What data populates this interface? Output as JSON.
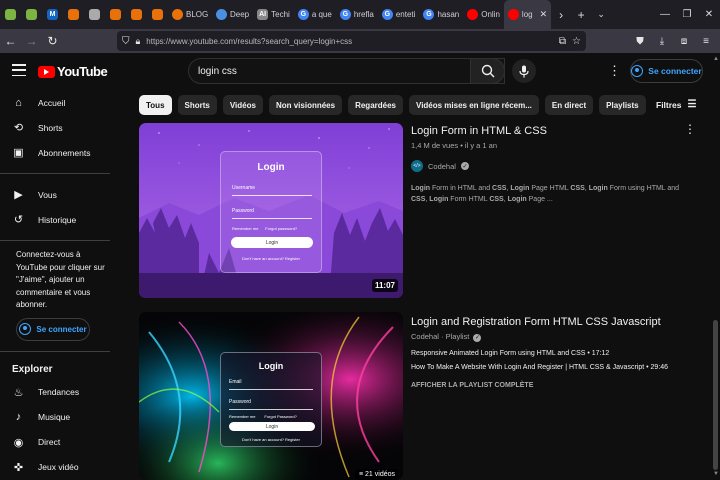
{
  "browser": {
    "tabs": [
      {
        "label": "",
        "color": "#7cb342",
        "letter": "",
        "pinned": true
      },
      {
        "label": "",
        "color": "#7cb342",
        "letter": "",
        "pinned": true
      },
      {
        "label": "",
        "color": "#1565c0",
        "letter": "M",
        "pinned": true
      },
      {
        "label": "",
        "color": "#e8710a",
        "letter": "",
        "pinned": true
      },
      {
        "label": "",
        "color": "#aaaaaa",
        "letter": "",
        "pinned": true
      },
      {
        "label": "",
        "color": "#e8710a",
        "letter": "",
        "pinned": true
      },
      {
        "label": "",
        "color": "#e8710a",
        "letter": "",
        "pinned": true
      },
      {
        "label": "",
        "color": "#e8710a",
        "letter": "",
        "pinned": true
      },
      {
        "label": "BLOG",
        "color": "#e8710a",
        "letter": ""
      },
      {
        "label": "Deep",
        "color": "#4a90e2",
        "letter": ""
      },
      {
        "label": "Techi",
        "color": "#888888",
        "letter": "AI"
      },
      {
        "label": "a que",
        "color": "#4285f4",
        "letter": "G"
      },
      {
        "label": "hrefla",
        "color": "#4285f4",
        "letter": "G"
      },
      {
        "label": "enteti",
        "color": "#4285f4",
        "letter": "G",
        "selected": true
      },
      {
        "label": "hasan",
        "color": "#4285f4",
        "letter": "G"
      },
      {
        "label": "Onlin",
        "color": "#ff0000",
        "letter": ""
      },
      {
        "label": "log",
        "color": "#ff0000",
        "letter": "",
        "active": true
      }
    ],
    "url": "https://www.youtube.com/results?search_query=login+css"
  },
  "header": {
    "logo_text": "YouTube",
    "search_value": "login css",
    "signin_label": "Se connecter"
  },
  "sidebar": {
    "items": [
      {
        "label": "Accueil",
        "icon": "home-icon",
        "glyph": "⌂"
      },
      {
        "label": "Shorts",
        "icon": "shorts-icon",
        "glyph": "⟲"
      },
      {
        "label": "Abonnements",
        "icon": "subscriptions-icon",
        "glyph": "▣"
      }
    ],
    "items2": [
      {
        "label": "Vous",
        "icon": "you-icon",
        "glyph": "▶"
      },
      {
        "label": "Historique",
        "icon": "history-icon",
        "glyph": "↺"
      }
    ],
    "signin_message": "Connectez-vous à YouTube pour cliquer sur \"J'aime\", ajouter un commentaire et vous abonner.",
    "signin_label": "Se connecter",
    "explore_title": "Explorer",
    "explore_items": [
      {
        "label": "Tendances",
        "icon": "trending-icon",
        "glyph": "♨"
      },
      {
        "label": "Musique",
        "icon": "music-icon",
        "glyph": "♪"
      },
      {
        "label": "Direct",
        "icon": "live-icon",
        "glyph": "◉"
      },
      {
        "label": "Jeux vidéo",
        "icon": "gaming-icon",
        "glyph": "✜"
      }
    ]
  },
  "chips": [
    "Tous",
    "Shorts",
    "Vidéos",
    "Non visionnées",
    "Regardées",
    "Vidéos mises en ligne récem...",
    "En direct",
    "Playlists"
  ],
  "filters_label": "Filtres",
  "results": [
    {
      "title": "Login Form in HTML & CSS",
      "meta": "1,4 M de vues • il y a 1 an",
      "channel": "Codehal",
      "duration": "11:07",
      "description_parts": [
        "Login",
        " Form in HTML and ",
        "CSS",
        ", ",
        "Login",
        " Page HTML ",
        "CSS",
        ", ",
        "Login",
        " Form using HTML and ",
        "CSS",
        ", ",
        "Login",
        " Form HTML ",
        "CSS",
        ", ",
        "Login",
        " Page ..."
      ],
      "thumb": {
        "title": "Login",
        "field1": "Username",
        "field2": "Password",
        "remember": "Remember me",
        "forgot": "Forgot password?",
        "button": "Login",
        "footer": "Don't have an account? Register"
      }
    },
    {
      "title": "Login and Registration Form HTML CSS Javascript",
      "channel_line": "Codehal · Playlist",
      "videos": [
        {
          "title": "Responsive Animated Login Form using HTML and CSS",
          "duration": "17:12"
        },
        {
          "title": "How To Make A Website With Login And Register | HTML CSS & Javascript",
          "duration": "29:46"
        }
      ],
      "view_all": "AFFICHER LA PLAYLIST COMPLÈTE",
      "count": "21 vidéos",
      "thumb": {
        "title": "Login",
        "field1": "Email",
        "field2": "Password",
        "remember": "Remember me",
        "forgot": "Forgot Password?",
        "button": "Login",
        "footer": "Don't have an account? Register"
      }
    }
  ]
}
